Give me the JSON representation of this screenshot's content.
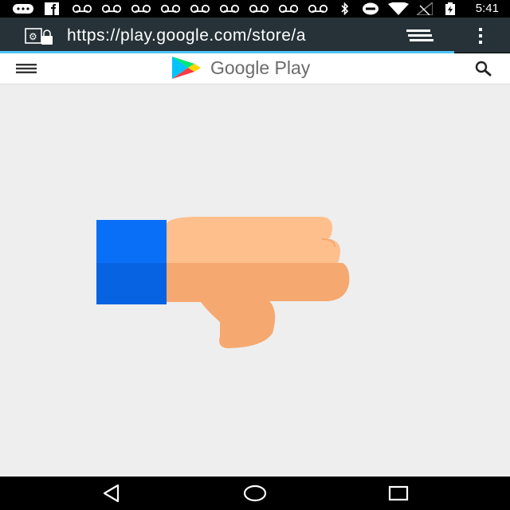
{
  "status_bar": {
    "time": "5:41",
    "icons": [
      "more-icon",
      "facebook-icon",
      "voicemail-icon",
      "voicemail-icon",
      "voicemail-icon",
      "voicemail-icon",
      "voicemail-icon",
      "voicemail-icon",
      "voicemail-icon",
      "voicemail-icon",
      "voicemail-icon",
      "bluetooth-icon",
      "do-not-disturb-icon",
      "wifi-icon",
      "no-signal-icon",
      "battery-charging-icon"
    ]
  },
  "browser": {
    "url": "https://play.google.com/store/a",
    "progress_fraction": 0.89
  },
  "app_bar": {
    "brand": "Google Play"
  },
  "illustration": {
    "name": "thumbs-down-illustration",
    "colors": {
      "cuff_light": "#0a6ff7",
      "cuff_dark": "#0863e2",
      "hand_light": "#ffbf8c",
      "hand_dark": "#f5a870"
    }
  },
  "nav_bar": {
    "buttons": [
      "back-button",
      "home-button",
      "recents-button"
    ]
  }
}
